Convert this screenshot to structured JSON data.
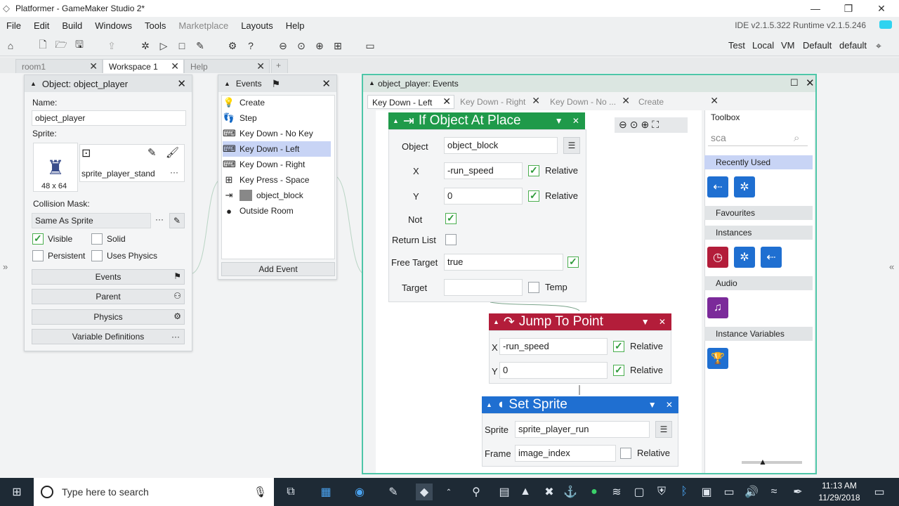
{
  "window": {
    "title": "Platformer - GameMaker Studio 2*"
  },
  "menu": {
    "items": [
      "File",
      "Edit",
      "Build",
      "Windows",
      "Tools",
      "Marketplace",
      "Layouts",
      "Help"
    ],
    "version": "IDE v2.1.5.322 Runtime v2.1.5.246"
  },
  "targets": {
    "items": [
      "Test",
      "Local",
      "VM",
      "Default",
      "default"
    ]
  },
  "tabs": [
    {
      "label": "room1"
    },
    {
      "label": "Workspace 1"
    },
    {
      "label": "Help"
    },
    {
      "label": "+"
    }
  ],
  "object_panel": {
    "title": "Object: object_player",
    "name_label": "Name:",
    "name_value": "object_player",
    "sprite_label": "Sprite:",
    "sprite_name": "sprite_player_stand",
    "sprite_size": "48 x 64",
    "collision_label": "Collision Mask:",
    "collision_value": "Same As Sprite",
    "visible": "Visible",
    "solid": "Solid",
    "persistent": "Persistent",
    "uses_physics": "Uses Physics",
    "buttons": [
      "Events",
      "Parent",
      "Physics",
      "Variable Definitions"
    ],
    "dots": "···"
  },
  "events_panel": {
    "title": "Events",
    "items": [
      "Create",
      "Step",
      "Key Down - No Key",
      "Key Down - Left",
      "Key Down - Right",
      "Key Press - Space",
      "object_block",
      "Outside Room"
    ],
    "add_label": "Add Event"
  },
  "editor": {
    "title": "object_player: Events",
    "tabs": [
      "Key Down - Left",
      "Key Down - Right",
      "Key Down - No ...",
      "Create"
    ]
  },
  "block_if": {
    "title": "If Object At Place",
    "object_label": "Object",
    "object_value": "object_block",
    "x_label": "X",
    "x_value": "-run_speed",
    "y_label": "Y",
    "y_value": "0",
    "relative": "Relative",
    "not_label": "Not",
    "return_list": "Return List",
    "free_target_label": "Free Target",
    "free_target_value": "true",
    "target_label": "Target",
    "temp": "Temp",
    "color": "#1f9a4a"
  },
  "block_jump": {
    "title": "Jump To Point",
    "x_label": "X",
    "x_value": "-run_speed",
    "y_label": "Y",
    "y_value": "0",
    "relative": "Relative",
    "color": "#b31d3a"
  },
  "block_sprite": {
    "title": "Set Sprite",
    "sprite_label": "Sprite",
    "sprite_value": "sprite_player_run",
    "frame_label": "Frame",
    "frame_value": "image_index",
    "relative": "Relative",
    "color": "#1f6fd1"
  },
  "toolbox": {
    "title": "Toolbox",
    "search": "sca",
    "sections": [
      "Recently Used",
      "Favourites",
      "Instances",
      "Audio",
      "Instance Variables"
    ]
  },
  "taskbar": {
    "search_placeholder": "Type here to search",
    "time": "11:13 AM",
    "date": "11/29/2018"
  }
}
